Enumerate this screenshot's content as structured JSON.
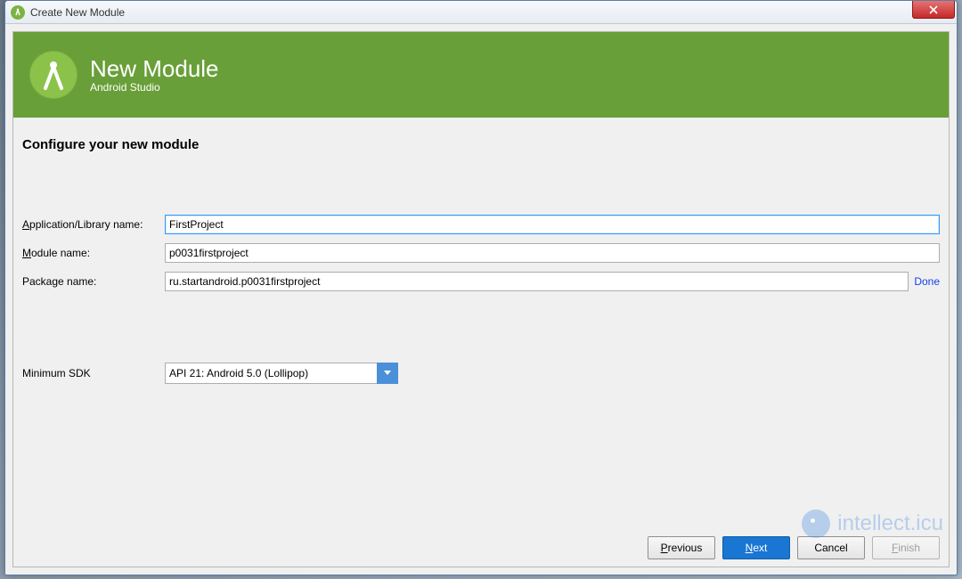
{
  "window": {
    "title": "Create New Module"
  },
  "header": {
    "title": "New Module",
    "subtitle": "Android Studio"
  },
  "section": {
    "title": "Configure your new module"
  },
  "form": {
    "app_name_label_pre": "A",
    "app_name_label_rest": "pplication/Library name:",
    "app_name_value": "FirstProject",
    "module_name_label_pre": "M",
    "module_name_label_rest": "odule name:",
    "module_name_value": "p0031firstproject",
    "package_name_label": "Package name:",
    "package_name_value": "ru.startandroid.p0031firstproject",
    "done_link": "Done",
    "min_sdk_label": "Minimum SDK",
    "min_sdk_value": "API 21: Android 5.0 (Lollipop)"
  },
  "footer": {
    "previous_pre": "P",
    "previous_rest": "revious",
    "next_pre": "N",
    "next_rest": "ext",
    "cancel": "Cancel",
    "finish_pre": "F",
    "finish_rest": "inish"
  },
  "watermark": {
    "text": "intellect.icu"
  }
}
